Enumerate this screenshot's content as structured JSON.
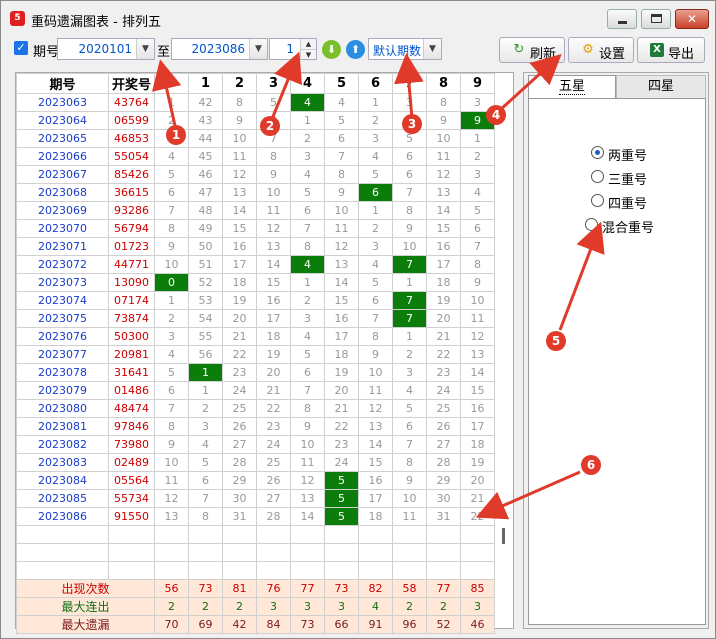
{
  "window": {
    "title": "重码遗漏图表 - 排列五",
    "icon_label": "5"
  },
  "toolbar": {
    "period_label": "期号",
    "from_value": "2020101",
    "to_label": "至",
    "to_value": "2023086",
    "count_value": "1",
    "default_option": "默认期数",
    "refresh_label": "刷新",
    "settings_label": "设置",
    "export_label": "导出"
  },
  "table": {
    "headers": [
      "期号",
      "开奖号",
      "0",
      "1",
      "2",
      "3",
      "4",
      "5",
      "6",
      "7",
      "8",
      "9"
    ],
    "rows": [
      {
        "period": "2023063",
        "draw": "43764",
        "cells": [
          "1",
          "42",
          "8",
          "5",
          "4",
          "4",
          "1",
          "3",
          "8",
          "3"
        ],
        "hits": [
          4
        ]
      },
      {
        "period": "2023064",
        "draw": "06599",
        "cells": [
          "2",
          "43",
          "9",
          "6",
          "1",
          "5",
          "2",
          "4",
          "9",
          "9"
        ],
        "hits": [
          9
        ]
      },
      {
        "period": "2023065",
        "draw": "46853",
        "cells": [
          "3",
          "44",
          "10",
          "7",
          "2",
          "6",
          "3",
          "5",
          "10",
          "1"
        ],
        "hits": []
      },
      {
        "period": "2023066",
        "draw": "55054",
        "cells": [
          "4",
          "45",
          "11",
          "8",
          "3",
          "7",
          "4",
          "6",
          "11",
          "2"
        ],
        "hits": []
      },
      {
        "period": "2023067",
        "draw": "85426",
        "cells": [
          "5",
          "46",
          "12",
          "9",
          "4",
          "8",
          "5",
          "6",
          "12",
          "3"
        ],
        "hits": []
      },
      {
        "period": "2023068",
        "draw": "36615",
        "cells": [
          "6",
          "47",
          "13",
          "10",
          "5",
          "9",
          "6",
          "7",
          "13",
          "4"
        ],
        "hits": [
          6
        ]
      },
      {
        "period": "2023069",
        "draw": "93286",
        "cells": [
          "7",
          "48",
          "14",
          "11",
          "6",
          "10",
          "1",
          "8",
          "14",
          "5"
        ],
        "hits": []
      },
      {
        "period": "2023070",
        "draw": "56794",
        "cells": [
          "8",
          "49",
          "15",
          "12",
          "7",
          "11",
          "2",
          "9",
          "15",
          "6"
        ],
        "hits": []
      },
      {
        "period": "2023071",
        "draw": "01723",
        "cells": [
          "9",
          "50",
          "16",
          "13",
          "8",
          "12",
          "3",
          "10",
          "16",
          "7"
        ],
        "hits": []
      },
      {
        "period": "2023072",
        "draw": "44771",
        "cells": [
          "10",
          "51",
          "17",
          "14",
          "4",
          "13",
          "4",
          "7",
          "17",
          "8"
        ],
        "hits": [
          4,
          7
        ]
      },
      {
        "period": "2023073",
        "draw": "13090",
        "cells": [
          "0",
          "52",
          "18",
          "15",
          "1",
          "14",
          "5",
          "1",
          "18",
          "9"
        ],
        "hits": [
          0
        ]
      },
      {
        "period": "2023074",
        "draw": "07174",
        "cells": [
          "1",
          "53",
          "19",
          "16",
          "2",
          "15",
          "6",
          "7",
          "19",
          "10"
        ],
        "hits": [
          7
        ]
      },
      {
        "period": "2023075",
        "draw": "73874",
        "cells": [
          "2",
          "54",
          "20",
          "17",
          "3",
          "16",
          "7",
          "7",
          "20",
          "11"
        ],
        "hits": [
          7
        ]
      },
      {
        "period": "2023076",
        "draw": "50300",
        "cells": [
          "3",
          "55",
          "21",
          "18",
          "4",
          "17",
          "8",
          "1",
          "21",
          "12"
        ],
        "hits": []
      },
      {
        "period": "2023077",
        "draw": "20981",
        "cells": [
          "4",
          "56",
          "22",
          "19",
          "5",
          "18",
          "9",
          "2",
          "22",
          "13"
        ],
        "hits": []
      },
      {
        "period": "2023078",
        "draw": "31641",
        "cells": [
          "5",
          "1",
          "23",
          "20",
          "6",
          "19",
          "10",
          "3",
          "23",
          "14"
        ],
        "hits": [
          1
        ]
      },
      {
        "period": "2023079",
        "draw": "01486",
        "cells": [
          "6",
          "1",
          "24",
          "21",
          "7",
          "20",
          "11",
          "4",
          "24",
          "15"
        ],
        "hits": []
      },
      {
        "period": "2023080",
        "draw": "48474",
        "cells": [
          "7",
          "2",
          "25",
          "22",
          "8",
          "21",
          "12",
          "5",
          "25",
          "16"
        ],
        "hits": []
      },
      {
        "period": "2023081",
        "draw": "97846",
        "cells": [
          "8",
          "3",
          "26",
          "23",
          "9",
          "22",
          "13",
          "6",
          "26",
          "17"
        ],
        "hits": []
      },
      {
        "period": "2023082",
        "draw": "73980",
        "cells": [
          "9",
          "4",
          "27",
          "24",
          "10",
          "23",
          "14",
          "7",
          "27",
          "18"
        ],
        "hits": []
      },
      {
        "period": "2023083",
        "draw": "02489",
        "cells": [
          "10",
          "5",
          "28",
          "25",
          "11",
          "24",
          "15",
          "8",
          "28",
          "19"
        ],
        "hits": []
      },
      {
        "period": "2023084",
        "draw": "05564",
        "cells": [
          "11",
          "6",
          "29",
          "26",
          "12",
          "5",
          "16",
          "9",
          "29",
          "20"
        ],
        "hits": [
          5
        ]
      },
      {
        "period": "2023085",
        "draw": "55734",
        "cells": [
          "12",
          "7",
          "30",
          "27",
          "13",
          "5",
          "17",
          "10",
          "30",
          "21"
        ],
        "hits": [
          5
        ]
      },
      {
        "period": "2023086",
        "draw": "91550",
        "cells": [
          "13",
          "8",
          "31",
          "28",
          "14",
          "5",
          "18",
          "11",
          "31",
          "22"
        ],
        "hits": [
          5
        ]
      }
    ],
    "empty_rows": 3,
    "stats": [
      {
        "label": "出现次数",
        "values": [
          "56",
          "73",
          "81",
          "76",
          "77",
          "73",
          "82",
          "58",
          "77",
          "85"
        ]
      },
      {
        "label": "最大连出",
        "values": [
          "2",
          "2",
          "2",
          "3",
          "3",
          "3",
          "4",
          "2",
          "2",
          "3"
        ]
      },
      {
        "label": "最大遗漏",
        "values": [
          "70",
          "69",
          "42",
          "84",
          "73",
          "66",
          "91",
          "96",
          "52",
          "46"
        ]
      }
    ]
  },
  "side_panel": {
    "tabs": [
      "五星",
      "四星"
    ],
    "active_tab": "五星",
    "options": [
      "两重号",
      "三重号",
      "四重号",
      "混合重号"
    ],
    "selected_option": "两重号"
  },
  "annotations": [
    "1",
    "2",
    "3",
    "4",
    "5",
    "6"
  ],
  "colors": {
    "hit": "#0a7d0a",
    "annotation": "#e03a2a",
    "period": "#1a3ccc",
    "draw": "#cc0000"
  }
}
